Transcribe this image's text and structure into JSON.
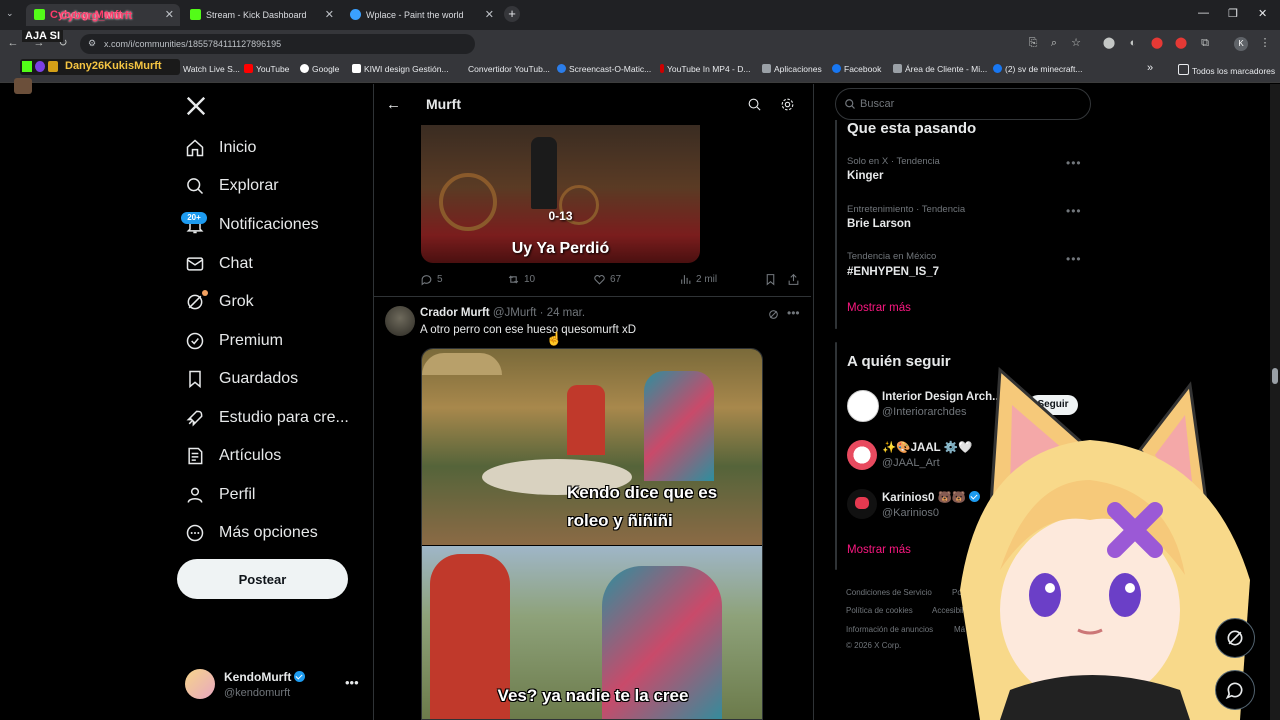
{
  "browser": {
    "tabs": [
      {
        "label": "Cyborg_Murft",
        "active": false
      },
      {
        "label": "Stream - Kick Dashboard",
        "active": false
      },
      {
        "label": "Wplace - Paint the world",
        "active": false
      }
    ],
    "new_tab": "+",
    "url": "x.com/i/communities/1855784111127896195",
    "bookmarks": [
      "Watch Live S...",
      "YouTube",
      "Google",
      "KIWI design Gestión...",
      "Convertidor YouTub...",
      "Screencast-O-Matic...",
      "YouTube In MP4 - D...",
      "Aplicaciones",
      "Facebook",
      "Área de Cliente - Mi...",
      "(2) sv de minecraft..."
    ],
    "bookmarks_more": "»",
    "all_bookmarks": "Todos los marcadores",
    "profile_letter": "K"
  },
  "stream_overlay": {
    "title": "Cyborg_Murft",
    "chat_line": "AJA SI",
    "user": "Dany26KukisMurft"
  },
  "nav": {
    "items": [
      {
        "label": "Inicio",
        "icon": "home-icon"
      },
      {
        "label": "Explorar",
        "icon": "search-icon"
      },
      {
        "label": "Notificaciones",
        "icon": "bell-icon",
        "badge": "20+"
      },
      {
        "label": "Chat",
        "icon": "mail-icon"
      },
      {
        "label": "Grok",
        "icon": "grok-icon"
      },
      {
        "label": "Premium",
        "icon": "premium-icon"
      },
      {
        "label": "Guardados",
        "icon": "bookmark-icon"
      },
      {
        "label": "Estudio para cre...",
        "icon": "rocket-icon"
      },
      {
        "label": "Artículos",
        "icon": "articles-icon"
      },
      {
        "label": "Perfil",
        "icon": "person-icon"
      },
      {
        "label": "Más opciones",
        "icon": "more-circle-icon"
      }
    ],
    "post_button": "Postear",
    "account": {
      "name": "KendoMurft",
      "handle": "@kendomurft"
    }
  },
  "header": {
    "title": "Murft"
  },
  "posts": [
    {
      "meme_score": "0-13",
      "meme_caption": "Uy Ya Perdió",
      "stats": {
        "replies": "5",
        "reposts": "10",
        "likes": "67",
        "views": "2 mil"
      }
    },
    {
      "author": "Crador Murft",
      "handle": "@JMurft",
      "time": "· 24 mar.",
      "text": "A otro perro con ese hueso quesomurft xD",
      "meme_top": "Kendo dice que es roleo y ñiñiñi",
      "meme_bottom": "Ves? ya nadie te la cree"
    }
  ],
  "sidebar": {
    "search_placeholder": "Buscar",
    "trends_title": "Que esta pasando",
    "trends": [
      {
        "category": "Solo en X · Tendencia",
        "name": "Kinger"
      },
      {
        "category": "Entretenimiento · Tendencia",
        "name": "Brie Larson"
      },
      {
        "category": "Tendencia en México",
        "name": "#ENHYPEN_IS_7"
      }
    ],
    "show_more": "Mostrar más",
    "follow_title": "A quién seguir",
    "follow": [
      {
        "name": "Interior Design Arch...",
        "handle": "@Interiorarchdes",
        "button": "Seguir"
      },
      {
        "name": "✨🎨JAAL ⚙️🤍",
        "handle": "@JAAL_Art"
      },
      {
        "name": "Karinios0 🐻🐻",
        "handle": "@Karinios0"
      }
    ],
    "follow_more": "Mostrar más",
    "footer": [
      "Condiciones de Servicio",
      "Polí",
      "Política de cookies",
      "Accesibili",
      "Información de anuncios",
      "Má",
      "© 2026 X Corp."
    ]
  },
  "colors": {
    "accent": "#1d9bf0",
    "link": "#f91880",
    "background": "#000000"
  }
}
